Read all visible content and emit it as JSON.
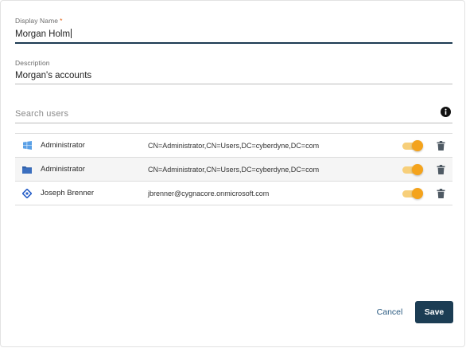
{
  "form": {
    "display_name_label": "Display Name",
    "required_mark": "*",
    "display_name_value": "Morgan Holm",
    "description_label": "Description",
    "description_value": "Morgan's accounts",
    "search_placeholder": "Search users"
  },
  "users": [
    {
      "icon": "windows-icon",
      "name": "Administrator",
      "dn": "CN=Administrator,CN=Users,DC=cyberdyne,DC=com",
      "enabled": true
    },
    {
      "icon": "folder-icon",
      "name": "Administrator",
      "dn": "CN=Administrator,CN=Users,DC=cyberdyne,DC=com",
      "enabled": true
    },
    {
      "icon": "azure-ad-icon",
      "name": "Joseph Brenner",
      "dn": "jbrenner@cygnacore.onmicrosoft.com",
      "enabled": true
    }
  ],
  "actions": {
    "cancel_label": "Cancel",
    "save_label": "Save"
  },
  "colors": {
    "accent": "#1c3d54",
    "toggle_on": "#f4a31c",
    "link": "#2a5a80"
  }
}
